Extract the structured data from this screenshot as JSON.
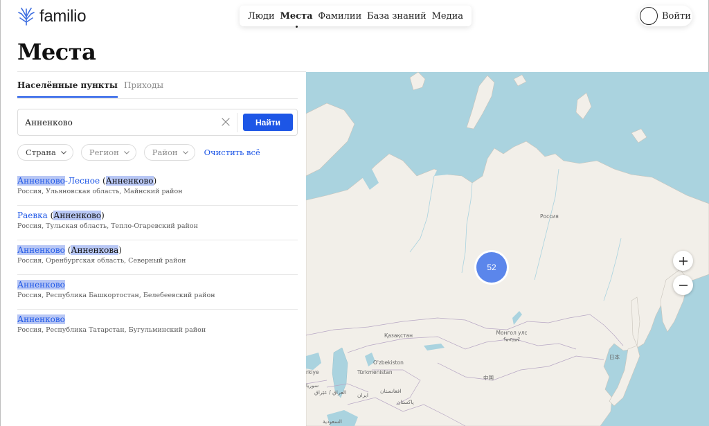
{
  "brand": {
    "name": "familio"
  },
  "nav": {
    "items": [
      {
        "label": "Люди",
        "active": false
      },
      {
        "label": "Места",
        "active": true
      },
      {
        "label": "Фамилии",
        "active": false
      },
      {
        "label": "База знаний",
        "active": false
      },
      {
        "label": "Медиа",
        "active": false
      }
    ]
  },
  "login": {
    "label": "Войти"
  },
  "page": {
    "title": "Места"
  },
  "tabs": [
    {
      "label": "Населённые пункты",
      "active": true
    },
    {
      "label": "Приходы",
      "active": false
    }
  ],
  "search": {
    "value": "Анненково",
    "button_label": "Найти"
  },
  "filters": {
    "country": "Страна",
    "region": "Регион",
    "district": "Район",
    "clear_all": "Очистить всё"
  },
  "results": [
    {
      "name": "Анненково",
      "name_rest": "-Лесное",
      "alt_name": "Анненково",
      "location": "Россия, Ульяновская область, Майнский район"
    },
    {
      "name": "",
      "name_rest": "Раевка",
      "alt_name": "Анненково",
      "location": "Россия, Тульская область, Тепло-Огаревский район"
    },
    {
      "name": "Анненково",
      "name_rest": "",
      "alt_name": "Анненкова",
      "location": "Россия, Оренбургская область, Северный район"
    },
    {
      "name": "Анненково",
      "name_rest": "",
      "alt_name": "",
      "location": "Россия, Республика Башкортостан, Белебеевский район"
    },
    {
      "name": "Анненково",
      "name_rest": "",
      "alt_name": "",
      "location": "Россия, Республика Татарстан, Бугульминский район"
    }
  ],
  "map": {
    "cluster_count": "52",
    "labels": {
      "russia": "Россия",
      "kazakhstan": "Қазақстан",
      "mongolia": "Монгол улс ᠮᠣᠩᠭᠣᠯ",
      "uzbekistan": "O'zbekiston",
      "turkmenistan": "Türkmenistan",
      "china": "中国",
      "japan": "日本",
      "iraq": "العراق / عێراق",
      "syria": "سوريا",
      "iran": "ایران",
      "afghanistan": "افغانستان",
      "pakistan": "پاکستان",
      "saudi": "السعودية",
      "turkey": "rkiye"
    },
    "colors": {
      "water": "#aad3df",
      "land": "#f2efe9",
      "cluster": "#5b86eb"
    }
  }
}
